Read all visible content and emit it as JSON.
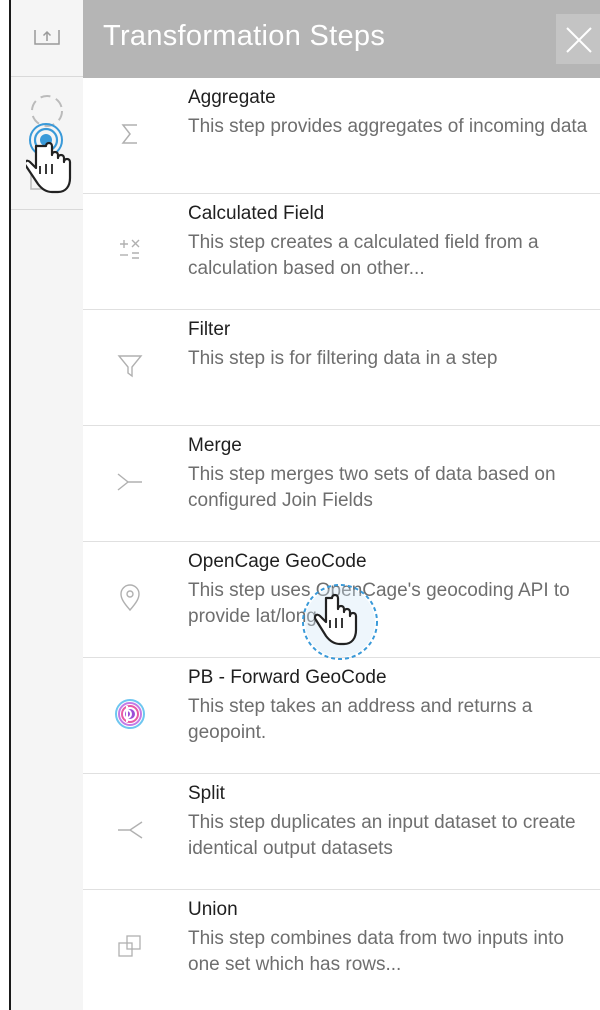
{
  "panel": {
    "title": "Transformation Steps"
  },
  "rail": {
    "items": [
      {
        "icon": "upload-icon"
      },
      {
        "icon": "loading-icon"
      },
      {
        "icon": "box-icon"
      }
    ]
  },
  "steps": [
    {
      "name": "Aggregate",
      "description": "This step provides aggregates of incoming data",
      "icon": "sigma-icon"
    },
    {
      "name": "Calculated Field",
      "description": "This step creates a calculated field from a calculation based on other...",
      "icon": "calculator-icon"
    },
    {
      "name": "Filter",
      "description": "This step is for filtering data in a step",
      "icon": "filter-icon"
    },
    {
      "name": "Merge",
      "description": "This step merges two sets of data based on configured Join Fields",
      "icon": "merge-icon"
    },
    {
      "name": "OpenCage GeoCode",
      "description": "This step uses OpenCage's geocoding API to provide lat/long...",
      "icon": "map-pin-icon"
    },
    {
      "name": "PB - Forward GeoCode",
      "description": "This step takes an address and returns a geopoint.",
      "icon": "pb-logo-icon"
    },
    {
      "name": "Split",
      "description": "This step duplicates an input dataset to create identical output datasets",
      "icon": "split-icon"
    },
    {
      "name": "Union",
      "description": "This step combines data from two inputs into one set which has rows...",
      "icon": "union-icon"
    }
  ],
  "colors": {
    "header_bg": "#b5b5b5",
    "icon_gray": "#b0b0b0",
    "cursor_ring": "#3a9ad9",
    "pb_logo": "#9b4fd6"
  }
}
